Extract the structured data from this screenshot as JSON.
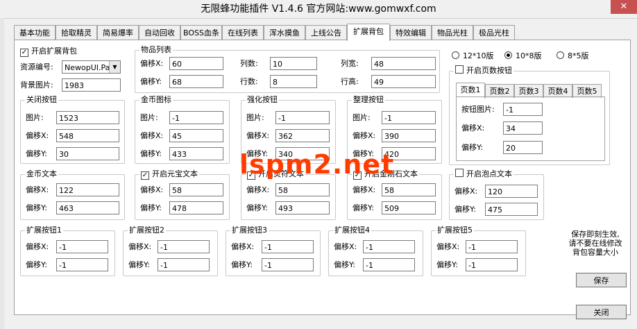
{
  "window": {
    "title": "无限蜂功能插件 V1.4.6   官方网站:www.gomwxf.com",
    "close_glyph": "✕"
  },
  "tabs": [
    "基本功能",
    "拾取精灵",
    "简易爆率",
    "自动回收",
    "BOSS血条",
    "在线列表",
    "浑水摸鱼",
    "上线公告",
    "扩展背包",
    "特效编辑",
    "物品光柱",
    "极品光柱"
  ],
  "active_tab": "扩展背包",
  "enable_bag": {
    "label": "开启扩展背包",
    "checked": true
  },
  "resource_id": {
    "label": "资源编号:",
    "value": "NewopUI.Pak"
  },
  "bg_image": {
    "label": "背景图片:",
    "value": "1983"
  },
  "item_list": {
    "title": "物品列表",
    "offset_x_label": "偏移X:",
    "offset_x": "60",
    "cols_label": "列数:",
    "cols": "10",
    "col_width_label": "列宽:",
    "col_width": "48",
    "offset_y_label": "偏移Y:",
    "offset_y": "68",
    "rows_label": "行数:",
    "rows": "8",
    "row_height_label": "行高:",
    "row_height": "49"
  },
  "layout_options": [
    {
      "label": "12*10版",
      "selected": false
    },
    {
      "label": "10*8版",
      "selected": true
    },
    {
      "label": "8*5版",
      "selected": false
    }
  ],
  "page_buttons": {
    "label": "开启页数按钮",
    "checked": false,
    "tabs": [
      "页数1",
      "页数2",
      "页数3",
      "页数4",
      "页数5"
    ],
    "image_label": "按钮图片:",
    "image": "-1",
    "offset_x_label": "偏移X:",
    "offset_x": "34",
    "offset_y_label": "偏移Y:",
    "offset_y": "20"
  },
  "close_button_group": {
    "title": "关闭按钮",
    "image_label": "图片:",
    "image": "1523",
    "x_label": "偏移X:",
    "x": "548",
    "y_label": "偏移Y:",
    "y": "30"
  },
  "gold_icon_group": {
    "title": "金币图标",
    "image_label": "图片:",
    "image": "-1",
    "x_label": "偏移X:",
    "x": "45",
    "y_label": "偏移Y:",
    "y": "433"
  },
  "enhance_group": {
    "title": "强化按钮",
    "image_label": "图片:",
    "image": "-1",
    "x_label": "偏移X:",
    "x": "362",
    "y_label": "偏移Y:",
    "y": "340"
  },
  "sort_group": {
    "title": "整理按钮",
    "image_label": "图片:",
    "image": "-1",
    "x_label": "偏移X:",
    "x": "390",
    "y_label": "偏移Y:",
    "y": "420"
  },
  "gold_text_group": {
    "title": "金币文本",
    "x_label": "偏移X:",
    "x": "122",
    "y_label": "偏移Y:",
    "y": "463"
  },
  "yuanbao_group": {
    "title": "开启元宝文本",
    "checked": true,
    "x_label": "偏移X:",
    "x": "58",
    "y_label": "偏移Y:",
    "y": "478"
  },
  "lingfu_group": {
    "title": "开启灵符文本",
    "checked": true,
    "x_label": "偏移X:",
    "x": "58",
    "y_label": "偏移Y:",
    "y": "493"
  },
  "diamond_group": {
    "title": "开启金刚石文本",
    "checked": true,
    "x_label": "偏移X:",
    "x": "58",
    "y_label": "偏移Y:",
    "y": "509"
  },
  "bubble_group": {
    "title": "开启泡点文本",
    "checked": false,
    "x_label": "偏移X:",
    "x": "120",
    "y_label": "偏移Y:",
    "y": "475"
  },
  "ext_buttons": [
    {
      "title": "扩展按钮1",
      "x_label": "偏移X:",
      "x": "-1",
      "y_label": "偏移Y:",
      "y": "-1"
    },
    {
      "title": "扩展按钮2",
      "x_label": "偏移X:",
      "x": "-1",
      "y_label": "偏移Y:",
      "y": "-1"
    },
    {
      "title": "扩展按钮3",
      "x_label": "偏移X:",
      "x": "-1",
      "y_label": "偏移Y:",
      "y": "-1"
    },
    {
      "title": "扩展按钮4",
      "x_label": "偏移X:",
      "x": "-1",
      "y_label": "偏移Y:",
      "y": "-1"
    },
    {
      "title": "扩展按钮5",
      "x_label": "偏移X:",
      "x": "-1",
      "y_label": "偏移Y:",
      "y": "-1"
    }
  ],
  "note": [
    "保存即刻生效,",
    "请不要在线修改",
    "背包容量大小"
  ],
  "save_label": "保存",
  "close_label": "关闭",
  "watermark": "lspm2.net"
}
